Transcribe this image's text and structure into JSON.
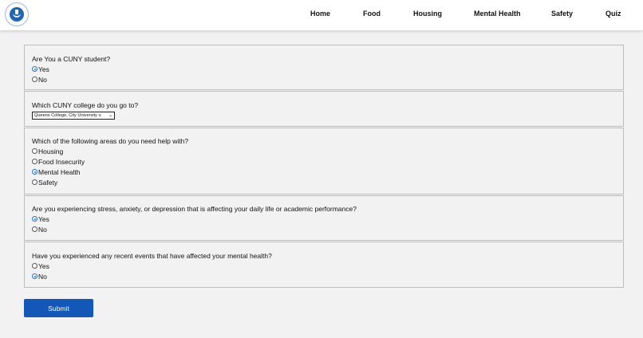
{
  "nav": {
    "logo_icon": "cuny-essentials-logo",
    "items": [
      "Home",
      "Food",
      "Housing",
      "Mental Health",
      "Safety",
      "Quiz"
    ]
  },
  "questions": [
    {
      "prompt": "Are You a CUNY student?",
      "options": [
        {
          "label": "Yes",
          "checked": true
        },
        {
          "label": "No",
          "checked": false
        }
      ]
    },
    {
      "prompt": "Which CUNY college do you go to?",
      "select_value": "Queens College, City University o"
    },
    {
      "prompt": "Which of the following areas do you need help with?",
      "options": [
        {
          "label": "Housing",
          "checked": false
        },
        {
          "label": "Food Insecurity",
          "checked": false
        },
        {
          "label": "Mental Health",
          "checked": true
        },
        {
          "label": "Safety",
          "checked": false
        }
      ]
    },
    {
      "prompt": "Are you experiencing stress, anxiety, or depression that is affecting your daily life or academic performance?",
      "options": [
        {
          "label": "Yes",
          "checked": true
        },
        {
          "label": "No",
          "checked": false
        }
      ]
    },
    {
      "prompt": "Have you experienced any recent events that have affected your mental health?",
      "options": [
        {
          "label": "Yes",
          "checked": false
        },
        {
          "label": "No",
          "checked": true
        }
      ]
    }
  ],
  "submit_label": "Submit",
  "colors": {
    "accent": "#1357b9",
    "radio_checked": "#1a6fe0",
    "background": "#f2f2f2"
  }
}
